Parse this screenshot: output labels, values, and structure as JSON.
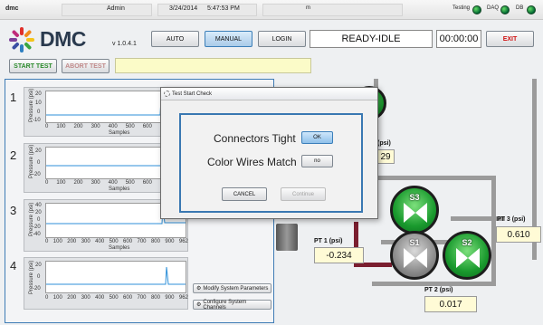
{
  "status_bar": {
    "app_name": "dmc",
    "user": "Admin",
    "date": "3/24/2014",
    "time": "5:47:53 PM",
    "indicator_mode": "m",
    "indicators": [
      {
        "label": "Testing",
        "color": "#1f9a3a"
      },
      {
        "label": "DAQ",
        "color": "#1f9a3a"
      },
      {
        "label": "DB",
        "color": "#1f9a3a"
      }
    ]
  },
  "header": {
    "logo_text": "DMC",
    "version": "v 1.0.4.1",
    "buttons": {
      "auto": "AUTO",
      "manual": "MANUAL",
      "login": "LOGIN",
      "exit": "EXIT"
    },
    "status_display": "READY-IDLE",
    "timer": "00:00:00"
  },
  "test_controls": {
    "start": "START TEST",
    "abort": "ABORT TEST",
    "message": ""
  },
  "graphs": {
    "ylabel": "Pressure (psi)",
    "xlabel": "Samples",
    "channels": [
      {
        "number": "1",
        "yticks": [
          "20",
          "10",
          "0",
          "-10"
        ],
        "xticks": [
          "0",
          "100",
          "200",
          "300",
          "400",
          "500",
          "600",
          "700",
          "800"
        ]
      },
      {
        "number": "2",
        "yticks": [
          "20",
          "0",
          "-20"
        ],
        "xticks": [
          "0",
          "100",
          "200",
          "300",
          "400",
          "500",
          "600",
          "700",
          "800"
        ]
      },
      {
        "number": "3",
        "yticks": [
          "40",
          "20",
          "0",
          "-20",
          "-40"
        ],
        "xticks": [
          "0",
          "100",
          "200",
          "300",
          "400",
          "500",
          "600",
          "700",
          "800",
          "900",
          "962"
        ]
      },
      {
        "number": "4",
        "yticks": [
          "20",
          "0",
          "-20"
        ],
        "xticks": [
          "0",
          "100",
          "200",
          "300",
          "400",
          "500",
          "600",
          "700",
          "800",
          "900",
          "962"
        ]
      }
    ],
    "buttons": {
      "modify": "Modify System Parameters",
      "configure": "Configure System Channels"
    }
  },
  "schematic": {
    "valves": [
      {
        "label": "T",
        "state": "green"
      },
      {
        "label": "S3",
        "state": "green"
      },
      {
        "label": "S1",
        "state": "gray"
      },
      {
        "label": "S2",
        "state": "green"
      }
    ],
    "sensors": [
      {
        "label": "PT 1 (psi)",
        "value": "-0.234"
      },
      {
        "label": "PT 2 (psi)",
        "value": "0.017"
      },
      {
        "label": "PT 3 (psi)",
        "value": "0.610"
      },
      {
        "label": "(psi)",
        "value": "29"
      }
    ]
  },
  "dialog": {
    "title": "Test Start Check",
    "check1_label": "Connectors Tight",
    "check1_button": "OK",
    "check2_label": "Color Wires Match",
    "check2_button": "no",
    "cancel": "CANCEL",
    "continue": "Continue"
  }
}
